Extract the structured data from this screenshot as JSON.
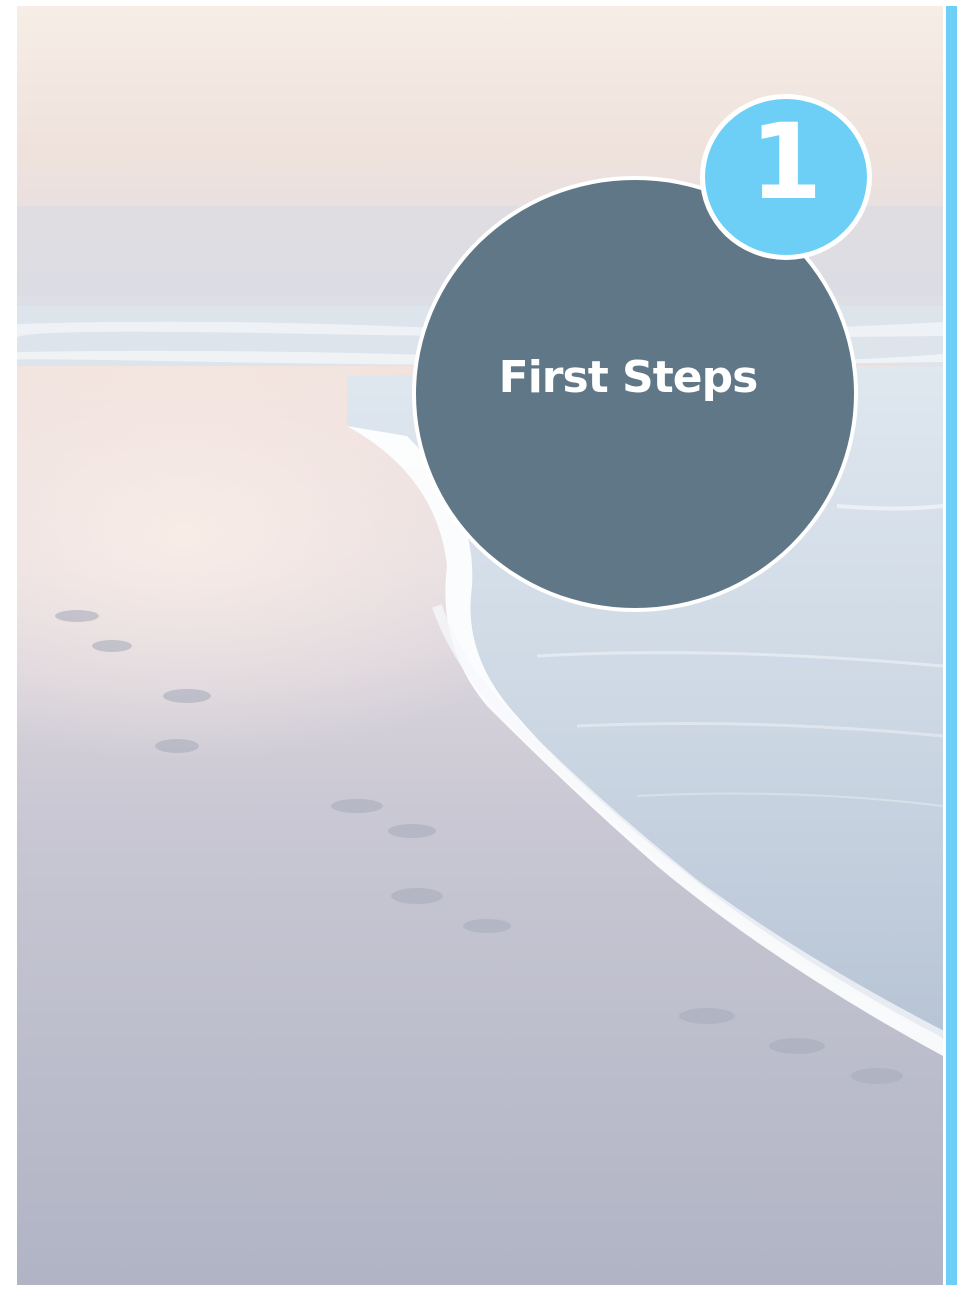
{
  "chapter": {
    "number": "1",
    "title": "First Steps"
  },
  "colors": {
    "accent": "#6dcff6",
    "circle": "#607787",
    "text": "#ffffff"
  },
  "image": {
    "subject": "beach-shoreline-photo"
  }
}
